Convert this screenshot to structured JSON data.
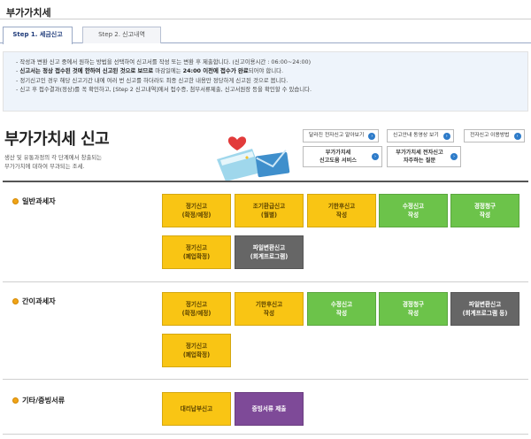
{
  "page": {
    "title": "부가가치세"
  },
  "tabs": [
    {
      "label": "Step 1. 세금신고"
    },
    {
      "label": "Step 2. 신고내역"
    }
  ],
  "notice": {
    "line1": "작성과 변환 신고 중에서 원하는 방법을 선택하여 신고서를 작성 또는 변환 후 제출합니다. (신고이용시간 : 06:00~24:00)",
    "line2_b1": "신고서는 정상 접수된 것에 한하여 신고된 것으로 보므로",
    "line2_mid": " 마감일에는 ",
    "line2_b2": "24:00 이전에 접수가 완료",
    "line2_end": "되어야 합니다.",
    "line3": "정기신고인 경우 해당 신고기간 내에 여러 번 신고를 하더라도 최종 신고한 내용만 정당하게 신고된 것으로 봅니다.",
    "line4": "신고 후 접수결과(정상)를 꼭 확인하고, [Step 2 신고내역]에서 접수증, 첨부서류제출, 신고서원장 등을 확인할 수 있습니다."
  },
  "header": {
    "title": "부가가치세 신고",
    "desc1": "생산 및 유통과정의 각 단계에서 창출되는",
    "desc2": "부가가치에 대하여 부과되는 조세."
  },
  "links": {
    "changed": "달라진 전자신고 알아보기",
    "video": "신고안내 동영상 보기",
    "howto": "전자신고 이용방법",
    "service_1": "부가가치세",
    "service_2": "신고도움 서비스",
    "faq_1": "부가가치세 전자신고",
    "faq_2": "자주하는 질문"
  },
  "sections": {
    "general": {
      "label": "일반과세자",
      "t1": [
        "정기신고",
        "(확정/예정)"
      ],
      "t2": [
        "조기환급신고",
        "(월별)"
      ],
      "t3": [
        "기한후신고",
        "작성"
      ],
      "t4": [
        "수정신고",
        "작성"
      ],
      "t5": [
        "경정청구",
        "작성"
      ],
      "t6": [
        "정기신고",
        "(폐업확정)"
      ],
      "t7": [
        "파일변환신고",
        "(회계프로그램)"
      ]
    },
    "simple": {
      "label": "간이과세자",
      "t1": [
        "정기신고",
        "(확정/예정)"
      ],
      "t2": [
        "기한후신고",
        "작성"
      ],
      "t3": [
        "수정신고",
        "작성"
      ],
      "t4": [
        "경정청구",
        "작성"
      ],
      "t5": [
        "파일변환신고",
        "(회계프로그램 등)"
      ],
      "t6": [
        "정기신고",
        "(폐업확정)"
      ]
    },
    "other": {
      "label": "기타/증빙서류",
      "t1": "대리납부신고",
      "t2": "증빙서류 제출"
    }
  },
  "colors": {
    "tile_yellow": "#f9c514",
    "tile_green": "#6cc34a",
    "tile_gray": "#666666",
    "tile_purple": "#7e4a98",
    "accent_blue": "#2d7bc9"
  }
}
